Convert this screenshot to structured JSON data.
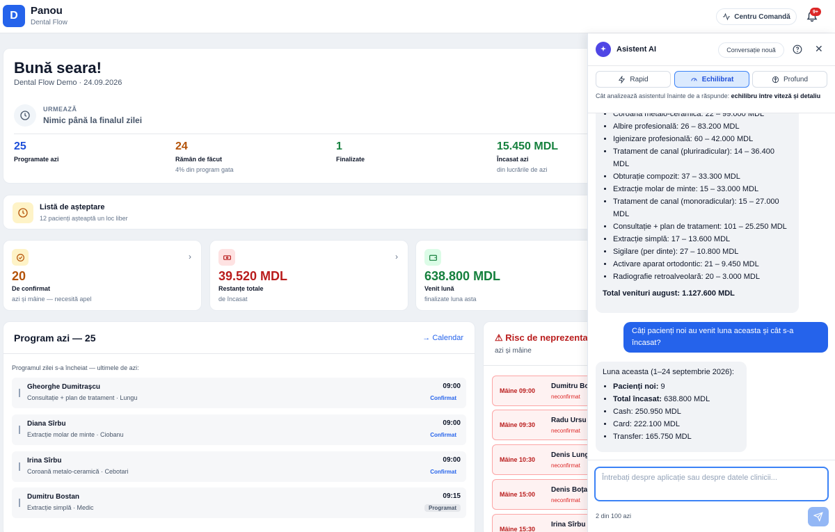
{
  "header": {
    "logo_letter": "D",
    "title": "Panou",
    "subtitle": "Dental Flow",
    "command_center": "Centru Comandă",
    "notif_badge": "9+"
  },
  "greeting": {
    "title": "Bună seara!",
    "subtitle": "Dental Flow Demo · 24.09.2026",
    "next_label": "URMEAZĂ",
    "next_value": "Nimic până la finalul zilei",
    "stats": [
      {
        "value": "25",
        "label": "Programate azi",
        "hint": "",
        "color": "#1d4ed8"
      },
      {
        "value": "24",
        "label": "Rămân de făcut",
        "hint": "4% din program gata",
        "color": "#b45309"
      },
      {
        "value": "1",
        "label": "Finalizate",
        "hint": "",
        "color": "#15803d"
      },
      {
        "value": "15.450 MDL",
        "label": "Încasat azi",
        "hint": "din lucrările de azi",
        "color": "#15803d"
      }
    ]
  },
  "waitlist": {
    "title": "Listă de așteptare",
    "subtitle": "12 pacienți așteaptă un loc liber"
  },
  "kpis": [
    {
      "value": "20",
      "label": "De confirmat",
      "hint": "azi și mâine — necesită apel",
      "color": "#b45309",
      "chevron": "›"
    },
    {
      "value": "39.520 MDL",
      "label": "Restanțe totale",
      "hint": "de încasat",
      "color": "#b91c1c",
      "chevron": "›"
    },
    {
      "value": "638.800 MDL",
      "label": "Venit lună",
      "hint": "finalizate luna asta",
      "color": "#15803d",
      "chevron": ""
    }
  ],
  "program": {
    "title": "Program azi — 25",
    "calendar_link": "→ Calendar",
    "note": "Programul zilei s-a încheiat — ultimele de azi:",
    "appointments": [
      {
        "name": "Gheorghe Dumitrașcu",
        "detail": "Consultație + plan de tratament · Lungu",
        "time": "09:00",
        "status": "Confirmat"
      },
      {
        "name": "Diana Sîrbu",
        "detail": "Extracție molar de minte · Ciobanu",
        "time": "09:00",
        "status": "Confirmat"
      },
      {
        "name": "Irina Sîrbu",
        "detail": "Coroană metalo-ceramică · Cebotari",
        "time": "09:00",
        "status": "Confirmat"
      },
      {
        "name": "Dumitru Bostan",
        "detail": "Extracție simplă · Medic",
        "time": "09:15",
        "status": "Programat"
      }
    ]
  },
  "risk": {
    "title": "⚠ Risc de neprezentare",
    "subtitle": "azi și mâine",
    "items": [
      {
        "when": "Mâine 09:00",
        "who": "Dumitru Bostan",
        "status": "neconfirmat"
      },
      {
        "when": "Mâine 09:30",
        "who": "Radu Ursu",
        "status": "neconfirmat"
      },
      {
        "when": "Mâine 10:30",
        "who": "Denis Lungu",
        "status": "neconfirmat"
      },
      {
        "when": "Mâine 15:00",
        "who": "Denis Boțan",
        "status": "neconfirmat"
      },
      {
        "when": "Mâine 15:30",
        "who": "Irina Sîrbu",
        "status": "neconfirmat"
      }
    ]
  },
  "assistant": {
    "title": "Asistent AI",
    "new_chat": "Conversație nouă",
    "modes": [
      {
        "label": "Rapid",
        "icon": "lightning-icon",
        "active": false
      },
      {
        "label": "Echilibrat",
        "icon": "gauge-icon",
        "active": true
      },
      {
        "label": "Profund",
        "icon": "brain-icon",
        "active": false
      }
    ],
    "mode_desc_prefix": "Cât analizează asistentul înainte de a răspunde: ",
    "mode_desc_bold": "echilibru între viteză și detaliu",
    "msg1_items": [
      "Coroană metalo-ceramică: 22 – 99.000 MDL",
      "Albire profesională: 26 – 83.200 MDL",
      "Igienizare profesională: 60 – 42.000 MDL",
      "Tratament de canal (pluriradicular): 14 – 36.400 MDL",
      "Obturație compozit: 37 – 33.300 MDL",
      "Extracție molar de minte: 15 – 33.000 MDL",
      "Tratament de canal (monoradicular): 15 – 27.000 MDL",
      "Consultație + plan de tratament: 101 – 25.250 MDL",
      "Extracție simplă: 17 – 13.600 MDL",
      "Sigilare (per dinte): 27 – 10.800 MDL",
      "Activare aparat ortodontic: 21 – 9.450 MDL",
      "Radiografie retroalveolară: 20 – 3.000 MDL"
    ],
    "msg1_total": "Total venituri august: 1.127.600 MDL",
    "user_msg": "Câți pacienți noi au venit luna aceasta și cât s-a încasat?",
    "msg2_intro": "Luna aceasta (1–24 septembrie 2026):",
    "msg2_items": [
      {
        "bold": "Pacienți noi:",
        "text": " 9"
      },
      {
        "bold": "Total încasat:",
        "text": " 638.800 MDL"
      },
      {
        "bold": "",
        "text": "Cash: 250.950 MDL"
      },
      {
        "bold": "",
        "text": "Card: 222.100 MDL"
      },
      {
        "bold": "",
        "text": "Transfer: 165.750 MDL"
      }
    ],
    "input_placeholder": "Întrebați despre aplicație sau despre datele clinicii...",
    "counter": "2 din 100 azi"
  }
}
